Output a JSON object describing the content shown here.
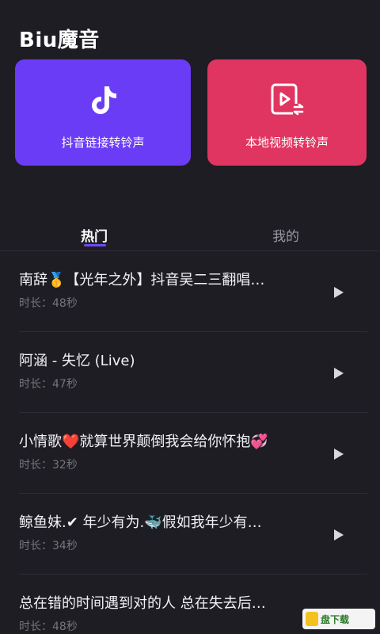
{
  "header": {
    "title": "Biu魔音"
  },
  "cards": {
    "douyin": {
      "label": "抖音链接转铃声",
      "icon": "tiktok-note-icon",
      "color": "#6b3cf5"
    },
    "local": {
      "label": "本地视频转铃声",
      "icon": "video-convert-icon",
      "color": "#df3560"
    }
  },
  "tabs": {
    "hot": "热门",
    "mine": "我的",
    "accent": "#7048f6"
  },
  "songs": [
    {
      "title": "南辞🥇【光年之外】抖音吴二三翻唱…",
      "duration": "时长：48秒"
    },
    {
      "title": "阿涵 - 失忆 (Live)",
      "duration": "时长：47秒"
    },
    {
      "title": "小情歌❤️就算世界颠倒我会给你怀抱💞",
      "duration": "时长：32秒"
    },
    {
      "title": "鲸鱼妹.✔ 年少有为.🐳假如我年少有…",
      "duration": "时长：34秒"
    },
    {
      "title": "总在错的时间遇到对的人 总在失去后…",
      "duration": "时长：48秒"
    }
  ],
  "watermark": {
    "text": "盘下载"
  }
}
